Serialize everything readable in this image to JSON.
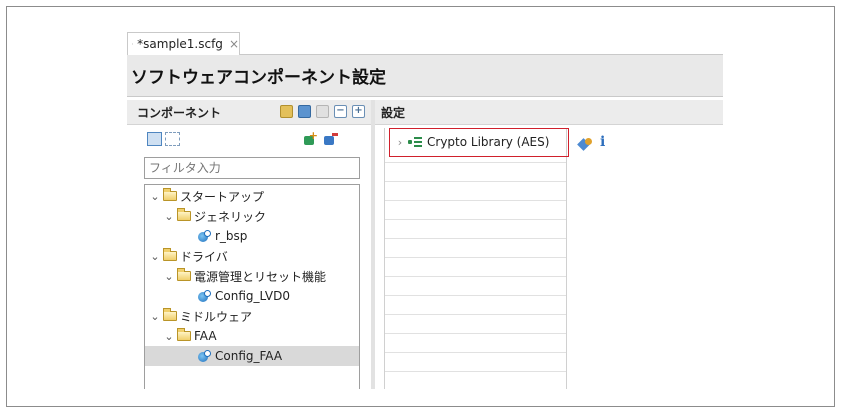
{
  "tab": {
    "label": "*sample1.scfg",
    "close": "×"
  },
  "title": "ソフトウェアコンポーネント設定",
  "left_panel": {
    "header": "コンポーネント",
    "filter_placeholder": "フィルタ入力",
    "tree": [
      {
        "label": "スタートアップ",
        "type": "folder",
        "level": 0,
        "expanded": true
      },
      {
        "label": "ジェネリック",
        "type": "folder",
        "level": 1,
        "expanded": true
      },
      {
        "label": "r_bsp",
        "type": "component",
        "level": 2
      },
      {
        "label": "ドライバ",
        "type": "folder",
        "level": 0,
        "expanded": true
      },
      {
        "label": "電源管理とリセット機能",
        "type": "folder",
        "level": 1,
        "expanded": true
      },
      {
        "label": "Config_LVD0",
        "type": "component",
        "level": 2
      },
      {
        "label": "ミドルウェア",
        "type": "folder",
        "level": 0,
        "expanded": true
      },
      {
        "label": "FAA",
        "type": "folder",
        "level": 1,
        "expanded": true
      },
      {
        "label": "Config_FAA",
        "type": "component",
        "level": 2,
        "selected": true
      }
    ]
  },
  "right_panel": {
    "header": "設定",
    "setting_label": "Crypto Library (AES)",
    "info_glyph": "i"
  },
  "colors": {
    "highlight": "#d0202c",
    "selection": "#d9d9d9",
    "header_bg": "#ececec",
    "title_bg": "#e9e9e9"
  },
  "icons": [
    "gear-icon",
    "close-icon",
    "folder-icon",
    "component-icon",
    "add-component-icon",
    "remove-component-icon",
    "library-icon",
    "info-icon"
  ]
}
